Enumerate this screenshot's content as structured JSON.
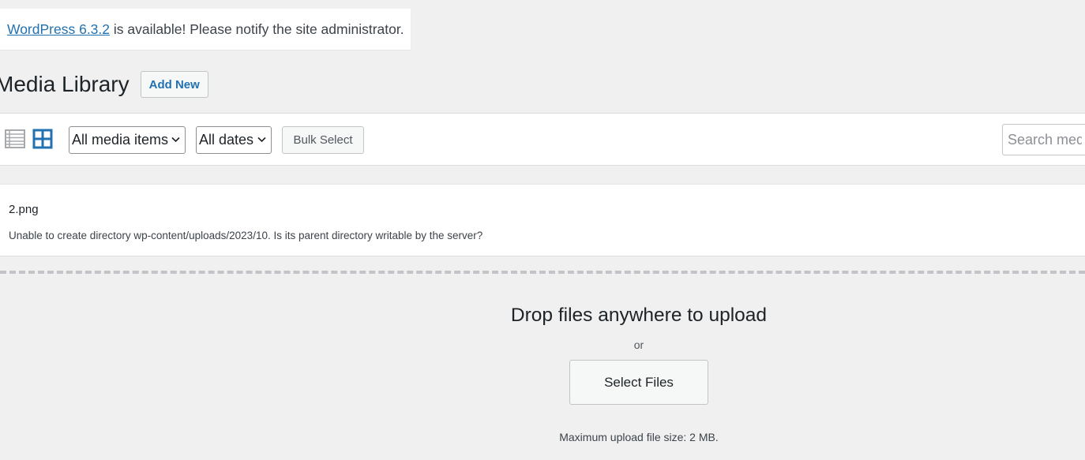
{
  "notice": {
    "link_text": "WordPress 6.3.2",
    "message": "is available! Please notify the site administrator."
  },
  "header": {
    "title": "Media Library",
    "add_new_label": "Add New"
  },
  "toolbar": {
    "list_view_icon": "list-view-icon",
    "grid_view_icon": "grid-view-icon",
    "grid_view_active": true,
    "media_filter_value": "All media items",
    "date_filter_value": "All dates",
    "bulk_select_label": "Bulk Select",
    "search_placeholder": "Search media"
  },
  "upload_error": {
    "filename": "2.png",
    "message": "Unable to create directory wp-content/uploads/2023/10. Is its parent directory writable by the server?"
  },
  "uploader": {
    "title": "Drop files anywhere to upload",
    "or_text": "or",
    "select_files_label": "Select Files",
    "max_size_text": "Maximum upload file size: 2 MB."
  },
  "colors": {
    "accent": "#2271b1",
    "page_bg": "#f0f0f1",
    "active_icon": "#2271b1",
    "inactive_icon": "#a7aaad"
  }
}
